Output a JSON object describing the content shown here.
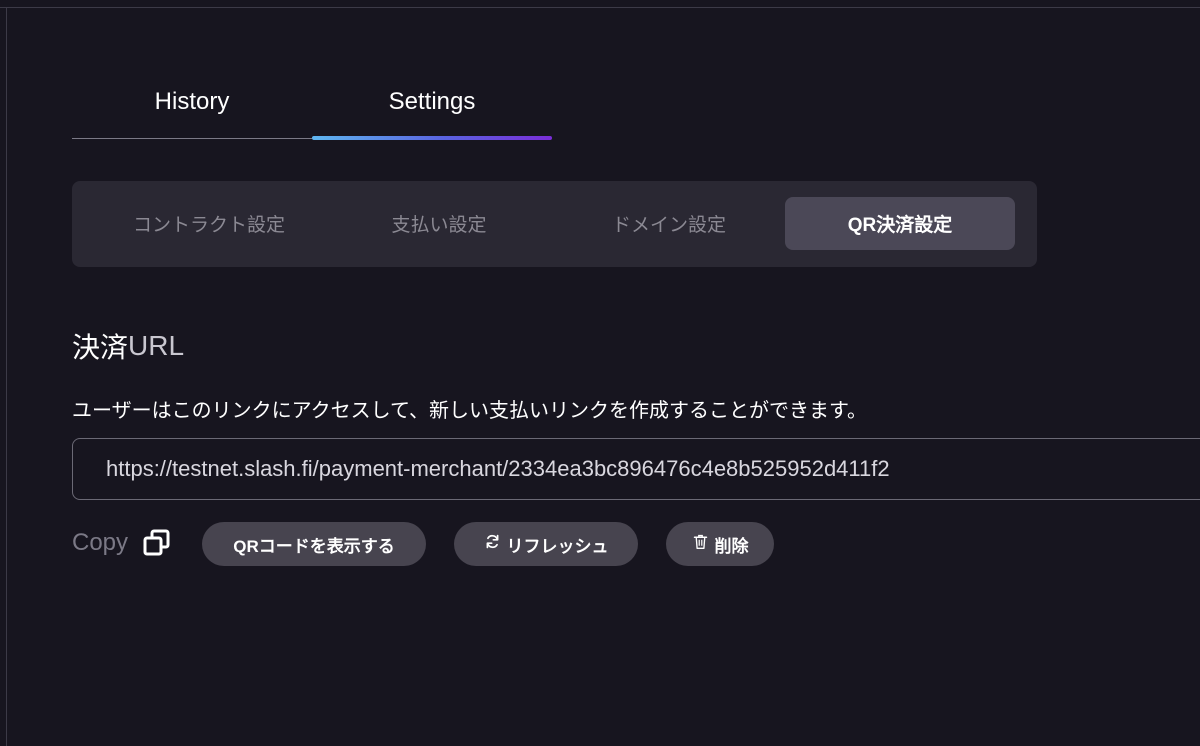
{
  "tabs": {
    "history_label": "History",
    "settings_label": "Settings",
    "active": "Settings"
  },
  "settings_nav": {
    "items": [
      {
        "label": "コントラクト設定",
        "active": false
      },
      {
        "label": "支払い設定",
        "active": false
      },
      {
        "label": "ドメイン設定",
        "active": false
      },
      {
        "label": "QR決済設定",
        "active": true
      }
    ]
  },
  "section": {
    "title_main": "決済",
    "title_url": "URL",
    "description": "ユーザーはこのリンクにアクセスして、新しい支払いリンクを作成することができます。"
  },
  "payment_url": {
    "value": "https://testnet.slash.fi/payment-merchant/2334ea3bc896476c4e8b525952d411f2"
  },
  "actions": {
    "copy_label": "Copy",
    "copy_icon": "copy-icon",
    "show_qr_label": "QRコードを表示する",
    "refresh_label": "リフレッシュ",
    "refresh_icon": "refresh-icon",
    "delete_label": "削除",
    "delete_icon": "trash-icon"
  },
  "colors": {
    "background": "#17151f",
    "panel": "#2a2833",
    "active_segment": "#4b4857",
    "pill": "#47444f",
    "tab_gradient_start": "#5fb6f0",
    "tab_gradient_end": "#7a2ed8"
  }
}
